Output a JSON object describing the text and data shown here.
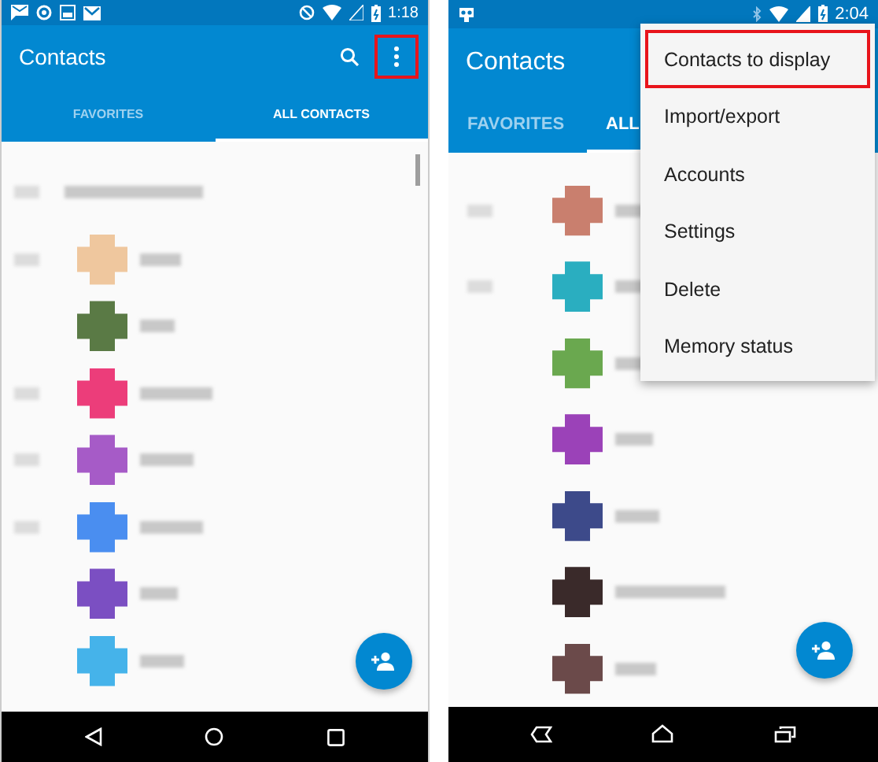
{
  "phones": [
    {
      "status_bar": {
        "time": "1:18"
      },
      "app_bar": {
        "title": "Contacts",
        "overflow_highlighted": true
      },
      "tabs": [
        {
          "label": "FAVORITES",
          "selected": false
        },
        {
          "label": "ALL CONTACTS",
          "selected": true
        }
      ],
      "contacts": [
        {
          "kind": "profile",
          "has_index": true
        },
        {
          "kind": "contact",
          "has_index": true,
          "color": "#efc79e"
        },
        {
          "kind": "contact",
          "has_index": false,
          "color": "#5a7a45"
        },
        {
          "kind": "contact",
          "has_index": true,
          "color": "#ec3d7a"
        },
        {
          "kind": "contact",
          "has_index": true,
          "color": "#a65bc7"
        },
        {
          "kind": "contact",
          "has_index": true,
          "color": "#4a8ef0"
        },
        {
          "kind": "contact",
          "has_index": false,
          "color": "#7b4fc2"
        },
        {
          "kind": "contact",
          "has_index": false,
          "color": "#45b3ea"
        }
      ]
    },
    {
      "status_bar": {
        "time": "2:04"
      },
      "app_bar": {
        "title": "Contacts"
      },
      "tabs": [
        {
          "label": "FAVORITES",
          "selected": false
        },
        {
          "label": "ALL",
          "selected": true
        }
      ],
      "menu": [
        {
          "label": "Contacts to display",
          "highlighted": true
        },
        {
          "label": "Import/export",
          "highlighted": false
        },
        {
          "label": "Accounts",
          "highlighted": false
        },
        {
          "label": "Settings",
          "highlighted": false
        },
        {
          "label": "Delete",
          "highlighted": false
        },
        {
          "label": "Memory status",
          "highlighted": false
        }
      ],
      "contacts": [
        {
          "kind": "contact",
          "has_index": true,
          "color": "#c97f6e"
        },
        {
          "kind": "contact",
          "has_index": true,
          "color": "#2aaec0"
        },
        {
          "kind": "contact",
          "has_index": false,
          "color": "#6aa84f"
        },
        {
          "kind": "contact",
          "has_index": false,
          "color": "#9b42b8"
        },
        {
          "kind": "contact",
          "has_index": false,
          "color": "#3d4a8a"
        },
        {
          "kind": "contact",
          "has_index": false,
          "color": "#3a2a2a"
        },
        {
          "kind": "contact",
          "has_index": false,
          "color": "#6b4a4a"
        }
      ]
    }
  ]
}
